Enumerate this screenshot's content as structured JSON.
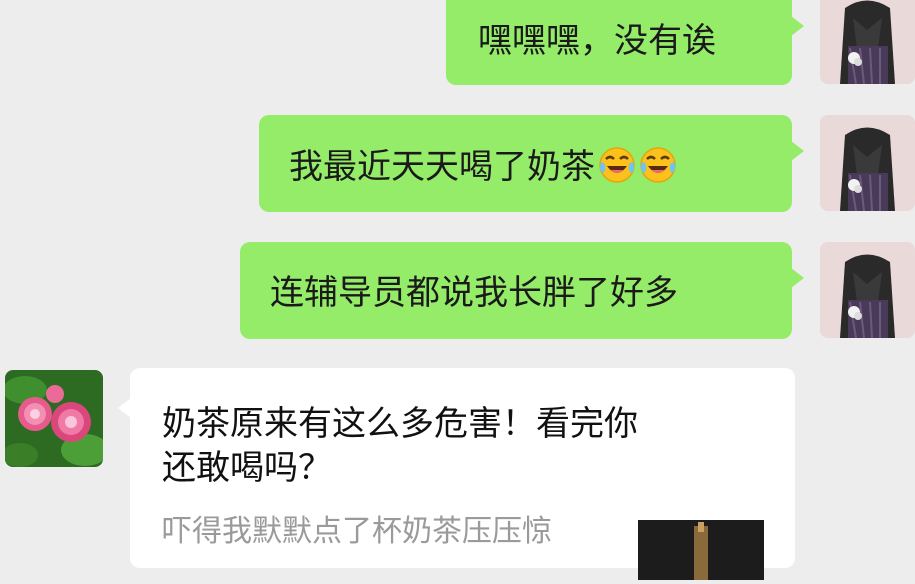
{
  "chat": {
    "messages": [
      {
        "sender": "me",
        "text": "嘿嘿嘿，没有诶"
      },
      {
        "sender": "me",
        "text": "我最近天天喝了奶茶",
        "emojis": [
          "laugh-cry-emoji",
          "laugh-cry-emoji"
        ]
      },
      {
        "sender": "me",
        "text": "连辅导员都说我长胖了好多"
      }
    ],
    "link_card": {
      "title_lines": [
        "奶茶原来有这么多危害！看完你",
        "还敢喝吗？"
      ],
      "description": "吓得我默默点了杯奶茶压压惊"
    }
  },
  "colors": {
    "background": "#ededed",
    "my_bubble": "#95ec69",
    "card_bubble": "#ffffff",
    "description_text": "#9a9a9a"
  },
  "icons": {
    "my_avatar": "girl-avatar",
    "contact_avatar": "peony-flower-avatar",
    "emoji": "laugh-cry-emoji"
  }
}
